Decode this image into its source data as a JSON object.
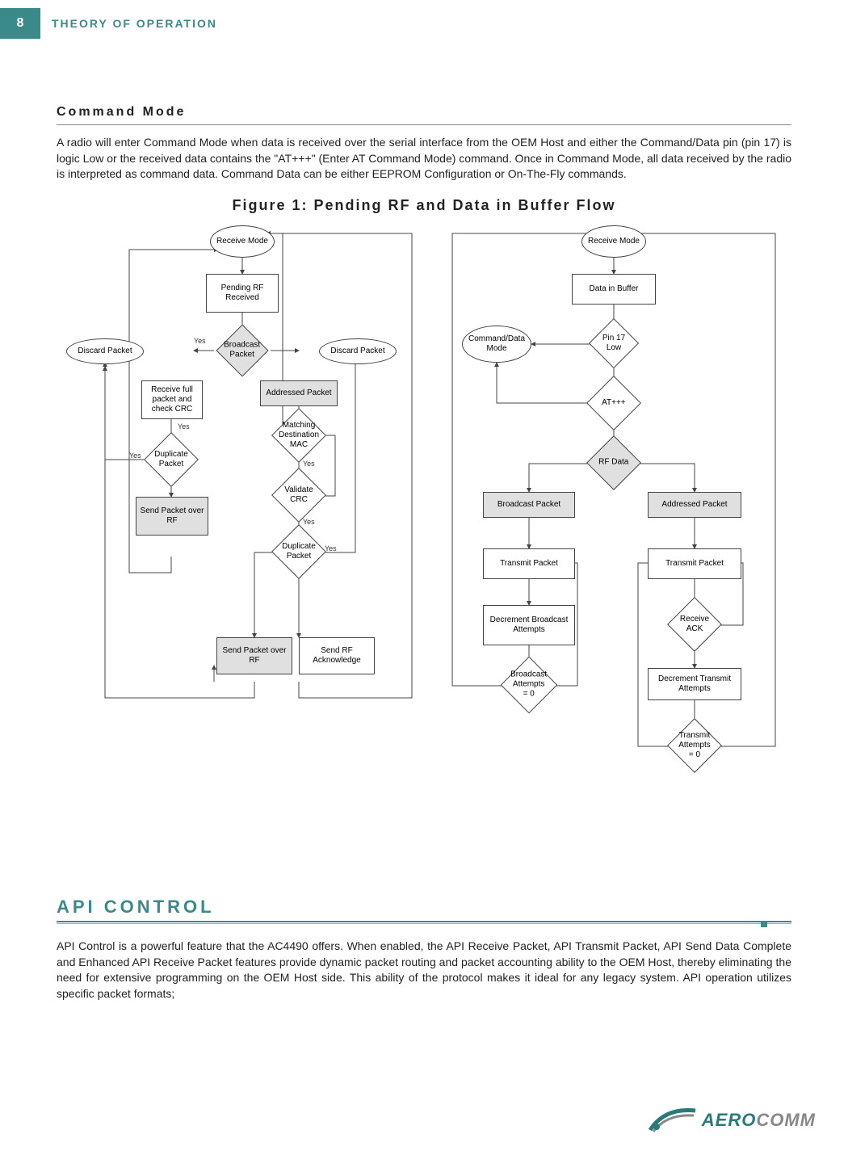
{
  "page_number": "8",
  "header_title": "THEORY OF OPERATION",
  "section1": {
    "title": "Command Mode",
    "body": "A radio will enter Command Mode when data is received over the serial interface from the OEM Host and either the Command/Data pin (pin 17) is logic Low or the received data contains the \"AT+++\" (Enter AT Command Mode) command.  Once in Command Mode, all data received by the radio is interpreted as command data.  Command Data can be either EEPROM Configuration or On-The-Fly commands."
  },
  "figure": {
    "title": "Figure 1: Pending RF and Data in Buffer Flow",
    "left": {
      "receive_mode": "Receive Mode",
      "pending_rf": "Pending RF Received",
      "broadcast_packet": "Broadcast Packet",
      "discard_left": "Discard Packet",
      "discard_right": "Discard Packet",
      "receive_full": "Receive full packet and check CRC",
      "addressed_packet": "Addressed Packet",
      "duplicate_packet1": "Duplicate Packet",
      "matching_mac": "Matching Destination MAC",
      "send_packet1": "Send Packet over RF",
      "validate_crc": "Validate CRC",
      "duplicate_packet2": "Duplicate Packet",
      "send_packet2": "Send Packet over RF",
      "send_ack": "Send RF Acknowledge",
      "yes1": "Yes",
      "yes2": "Yes",
      "yes3": "Yes",
      "yes4": "Yes",
      "yes5": "Yes",
      "yes6": "Yes"
    },
    "right": {
      "receive_mode": "Receive Mode",
      "data_in_buffer": "Data in Buffer",
      "command_data_mode": "Command/Data Mode",
      "pin17low": "Pin 17 Low",
      "at_plus": "AT+++",
      "rf_data": "RF Data",
      "broadcast_packet": "Broadcast Packet",
      "addressed_packet": "Addressed Packet",
      "transmit_packet1": "Transmit Packet",
      "transmit_packet2": "Transmit Packet",
      "decrement_broadcast": "Decrement Broadcast Attempts",
      "receive_ack": "Receive ACK",
      "broadcast_zero": "Broadcast Attempts = 0",
      "decrement_transmit": "Decrement Transmit Attempts",
      "transmit_zero": "Transmit Attempts = 0"
    }
  },
  "section2": {
    "title": "API CONTROL",
    "body": "API Control is a powerful feature that the AC4490 offers.  When enabled, the API Receive Packet, API Transmit Packet, API Send Data Complete and Enhanced API Receive Packet features provide dynamic packet routing and packet accounting ability to the OEM Host, thereby eliminating the need for extensive programming on the OEM Host side.  This ability of the protocol makes it ideal for any legacy system.  API operation utilizes specific packet formats;"
  },
  "logo": {
    "part1": "AERO",
    "part2": "COMM"
  }
}
